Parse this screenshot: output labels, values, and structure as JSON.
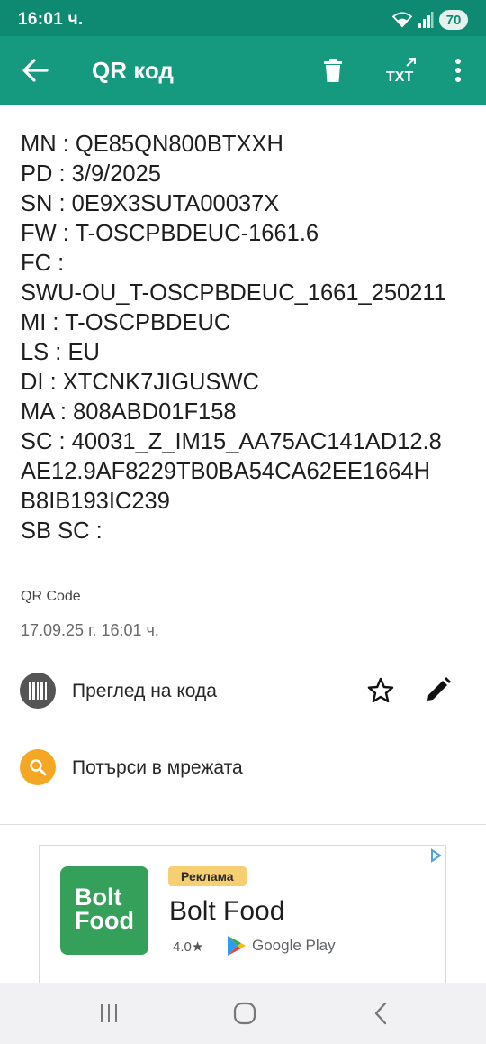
{
  "status_bar": {
    "time": "16:01 ч.",
    "battery": "70",
    "icons": [
      "wifi-icon",
      "signal-icon",
      "battery-icon"
    ]
  },
  "app_bar": {
    "title": "QR код",
    "actions": [
      "back-arrow-icon",
      "trash-icon",
      "txt-export-icon",
      "more-vert-icon"
    ]
  },
  "scan": {
    "text_lines": [
      "MN : QE85QN800BTXXH",
      "PD : 3/9/2025",
      "SN : 0E9X3SUTA00037X",
      "FW : T-OSCPBDEUC-1661.6",
      "FC :",
      "SWU-OU_T-OSCPBDEUC_1661_250211",
      "MI : T-OSCPBDEUC",
      "LS : EU",
      "DI : XTCNK7JIGUSWC",
      "MA : 808ABD01F158",
      "SC : 40031_Z_IM15_AA75AC141AD12.8",
      "AE12.9AF8229TB0BA54CA62EE1664H",
      "B8IB193IC239",
      "SB SC :"
    ],
    "format": "QR Code",
    "date": "17.09.25 г. 16:01 ч."
  },
  "actions": {
    "view_code": "Преглед на кода",
    "search_web": "Потърси в мрежата"
  },
  "ad": {
    "badge": "Реклама",
    "logo_line1": "Bolt",
    "logo_line2": "Food",
    "title": "Bolt Food",
    "rating": "4.0★",
    "store": "Google Play"
  },
  "colors": {
    "status_bar": "#0f8a72",
    "app_bar": "#169a7f",
    "barcode_circle": "#555555",
    "search_circle": "#f5a623",
    "ad_logo": "#35a05a",
    "ad_badge": "#f7cf73"
  }
}
